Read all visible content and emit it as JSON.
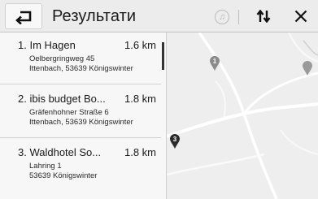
{
  "header": {
    "title": "Результати",
    "media_icon": "music-note-icon",
    "sort_icon": "sort-arrows-icon",
    "close_icon": "close-x-icon"
  },
  "results": [
    {
      "name": "1. Im Hagen",
      "distance": "1.6 km",
      "line1": "Oelbergringweg 45",
      "line2": "Ittenbach, 53639 Königswinter",
      "marker": "1"
    },
    {
      "name": "2. ibis budget Bo...",
      "distance": "1.8 km",
      "line1": "Gräfenhohner Straße 6",
      "line2": "Ittenbach, 53639 Königswinter",
      "marker": "2"
    },
    {
      "name": "3. Waldhotel So...",
      "distance": "1.8 km",
      "line1": "Lahring 1",
      "line2": "53639 Königswinter",
      "marker": "3"
    }
  ],
  "map": {
    "markers": [
      {
        "label": "1",
        "style": "grey"
      },
      {
        "label": "3",
        "style": "dark"
      }
    ]
  },
  "colors": {
    "header_bg": "#ececec",
    "list_bg": "#f7f7f7",
    "map_bg": "#eeeeee",
    "marker_grey": "#8a8a8a",
    "marker_dark": "#2b2b2b"
  }
}
